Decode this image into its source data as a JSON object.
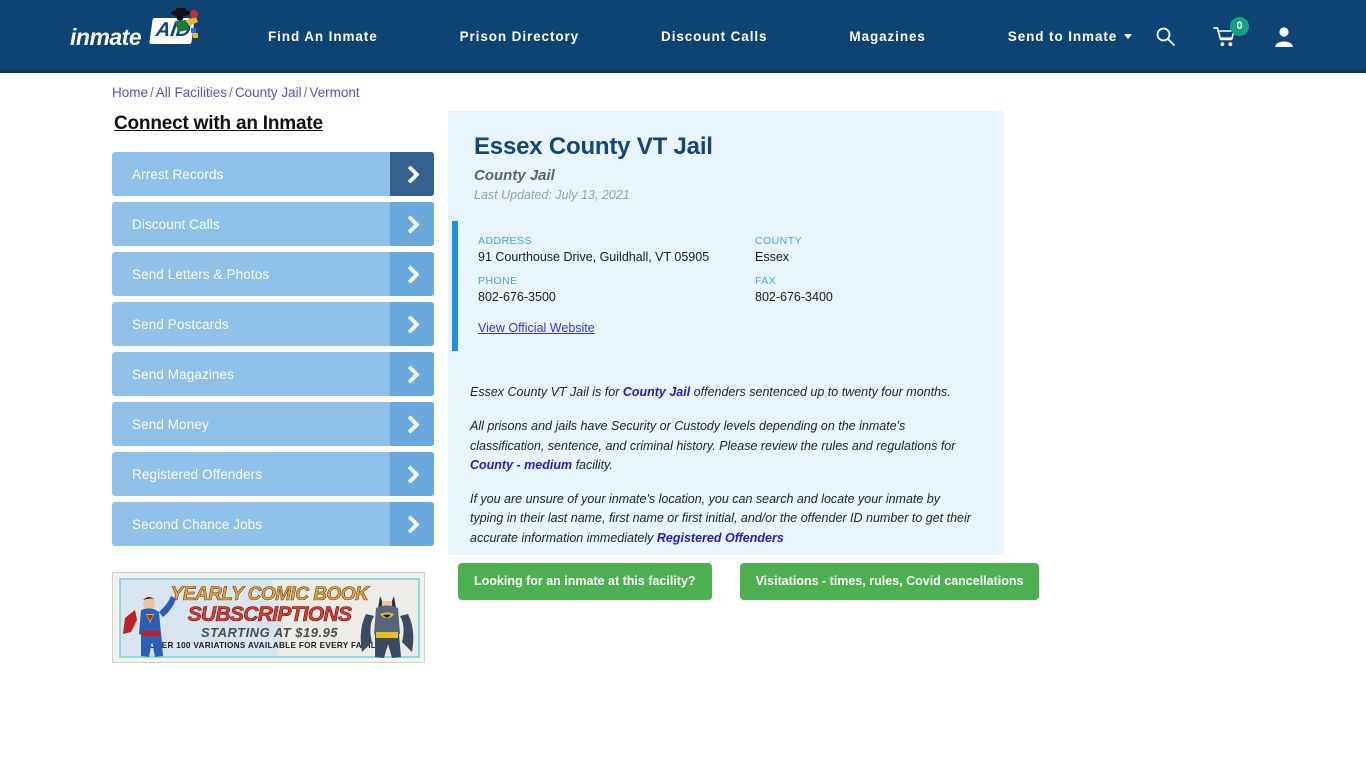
{
  "header": {
    "logo": {
      "text": "inmate",
      "badge": "AID",
      "figure_icon": "person-with-hat-icon"
    },
    "nav": [
      {
        "label": "Find An Inmate",
        "has_caret": false
      },
      {
        "label": "Prison Directory",
        "has_caret": false
      },
      {
        "label": "Discount Calls",
        "has_caret": false
      },
      {
        "label": "Magazines",
        "has_caret": false
      },
      {
        "label": "Send to Inmate",
        "has_caret": true
      }
    ],
    "icons": {
      "search": "search-icon",
      "cart": "shopping-cart-icon",
      "cart_count": "0",
      "account": "user-account-icon"
    },
    "bg_color": "#0d4474",
    "cart_badge_color": "#10a37f"
  },
  "breadcrumb": {
    "items": [
      "Home",
      "All Facilities",
      "County Jail",
      "Vermont"
    ],
    "separator": "/",
    "link_color": "#5a4bd8"
  },
  "sidebar": {
    "title": "Connect with an Inmate",
    "items": [
      {
        "label": "Arrest Records",
        "active": true
      },
      {
        "label": "Discount Calls",
        "active": false
      },
      {
        "label": "Send Letters & Photos",
        "active": false
      },
      {
        "label": "Send Postcards",
        "active": false
      },
      {
        "label": "Send Magazines",
        "active": false
      },
      {
        "label": "Send Money",
        "active": false
      },
      {
        "label": "Registered Offenders",
        "active": false
      },
      {
        "label": "Second Chance Jobs",
        "active": false
      }
    ],
    "button_color": "#8fc0e8",
    "arrow_color": "#6aa9dd",
    "arrow_active_color": "#35618f"
  },
  "ad": {
    "line1": "YEARLY COMIC BOOK",
    "line2": "SUBSCRIPTIONS",
    "line3": "STARTING AT $19.95",
    "line4": "OVER 100 VARIATIONS AVAILABLE FOR EVERY FACILITY",
    "left_hero": "superman-figure-icon",
    "right_hero": "batman-figure-icon"
  },
  "facility": {
    "name": "Essex County VT Jail",
    "type": "County Jail",
    "last_updated": "Last Updated: July 13, 2021",
    "accent_color": "#1a8fe8",
    "card_bg": "#e9f5fd",
    "info": {
      "address_label": "ADDRESS",
      "address_value": "91 Courthouse Drive, Guildhall, VT 05905",
      "county_label": "COUNTY",
      "county_value": "Essex",
      "phone_label": "PHONE",
      "phone_value": "802-676-3500",
      "fax_label": "FAX",
      "fax_value": "802-676-3400"
    },
    "official_website_link": "View Official Website",
    "paragraphs": {
      "p1_a": "Essex County VT Jail is for ",
      "p1_link": "County Jail",
      "p1_b": " offenders sentenced up to twenty four months.",
      "p2_a": "All prisons and jails have Security or Custody levels depending on the inmate's classification, sentence, and criminal history. Please review the rules and regulations for ",
      "p2_link": "County - medium",
      "p2_b": " facility.",
      "p3_a": "If you are unsure of your inmate's location, you can search and locate your inmate by typing in their last name, first name or first initial, and/or the offender ID number to get their accurate information immediately ",
      "p3_link": "Registered Offenders"
    }
  },
  "cta": {
    "primary": "Looking for an inmate at this facility?",
    "secondary": "Visitations - times, rules, Covid cancellations",
    "color": "#4caf50"
  }
}
